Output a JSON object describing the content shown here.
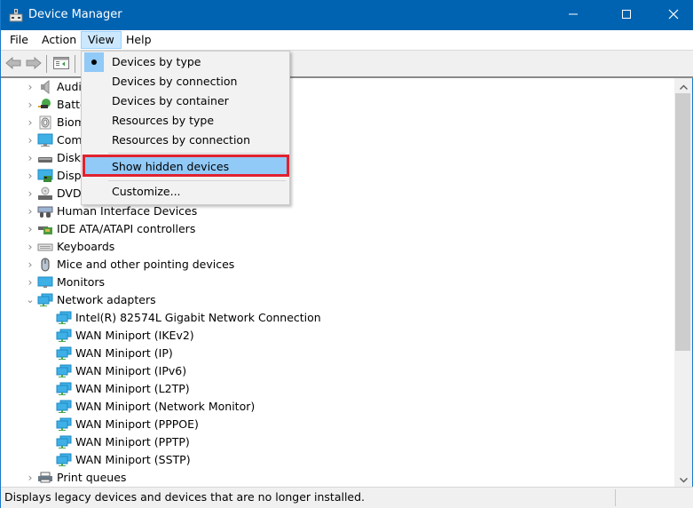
{
  "window": {
    "title": "Device Manager",
    "icons": {
      "app": "device-manager-icon",
      "minimize": "minimize-icon",
      "maximize": "maximize-icon",
      "close": "close-icon"
    },
    "title_color": "#0063b1"
  },
  "menubar": {
    "items": [
      {
        "label": "File"
      },
      {
        "label": "Action"
      },
      {
        "label": "View",
        "active": true
      },
      {
        "label": "Help"
      }
    ]
  },
  "toolbar": {
    "buttons": [
      {
        "name": "back",
        "icon": "arrow-left-icon"
      },
      {
        "name": "forward",
        "icon": "arrow-right-icon"
      },
      {
        "name": "show-hide-console-tree",
        "icon": "console-tree-icon"
      }
    ]
  },
  "view_menu": {
    "items": [
      {
        "label": "Devices by type",
        "checked": true
      },
      {
        "label": "Devices by connection"
      },
      {
        "label": "Devices by container"
      },
      {
        "label": "Resources by type"
      },
      {
        "label": "Resources by connection"
      },
      {
        "label": "Show hidden devices",
        "highlighted": true
      },
      {
        "label": "Customize..."
      }
    ],
    "highlight_color": "#91c9f7",
    "annotation_color": "#e0222e"
  },
  "tree": {
    "categories": [
      {
        "label": "Audio inputs and outputs",
        "visible_label": "Audi",
        "icon": "speaker-icon",
        "expanded": false
      },
      {
        "label": "Batteries",
        "visible_label": "Batte",
        "icon": "battery-icon",
        "expanded": false
      },
      {
        "label": "Biometric devices",
        "visible_label": "Biom",
        "icon": "fingerprint-icon",
        "expanded": false
      },
      {
        "label": "Computer",
        "visible_label": "Com",
        "icon": "computer-icon",
        "expanded": false
      },
      {
        "label": "Disk drives",
        "visible_label": "Disk",
        "icon": "disk-drive-icon",
        "expanded": false
      },
      {
        "label": "Display adapters",
        "visible_label": "Disp",
        "icon": "display-adapter-icon",
        "expanded": false
      },
      {
        "label": "DVD/CD-ROM drives",
        "visible_label": "DVD",
        "icon": "dvd-drive-icon",
        "expanded": false
      },
      {
        "label": "Human Interface Devices",
        "visible_label": "Human Interface Devices",
        "icon": "hid-icon",
        "expanded": false
      },
      {
        "label": "IDE ATA/ATAPI controllers",
        "visible_label": "IDE ATA/ATAPI controllers",
        "icon": "ide-controller-icon",
        "expanded": false
      },
      {
        "label": "Keyboards",
        "visible_label": "Keyboards",
        "icon": "keyboard-icon",
        "expanded": false
      },
      {
        "label": "Mice and other pointing devices",
        "visible_label": "Mice and other pointing devices",
        "icon": "mouse-icon",
        "expanded": false
      },
      {
        "label": "Monitors",
        "visible_label": "Monitors",
        "icon": "monitor-icon",
        "expanded": false
      },
      {
        "label": "Network adapters",
        "visible_label": "Network adapters",
        "icon": "network-adapter-icon",
        "expanded": true,
        "children": [
          "Intel(R) 82574L Gigabit Network Connection",
          "WAN Miniport (IKEv2)",
          "WAN Miniport (IP)",
          "WAN Miniport (IPv6)",
          "WAN Miniport (L2TP)",
          "WAN Miniport (Network Monitor)",
          "WAN Miniport (PPPOE)",
          "WAN Miniport (PPTP)",
          "WAN Miniport (SSTP)"
        ]
      },
      {
        "label": "Print queues",
        "visible_label": "Print queues",
        "icon": "printer-icon",
        "expanded": false
      }
    ]
  },
  "scrollbar": {
    "position_fraction": 0.0,
    "visible_fraction": 0.68
  },
  "statusbar": {
    "text": "Displays legacy devices and devices that are no longer installed."
  }
}
